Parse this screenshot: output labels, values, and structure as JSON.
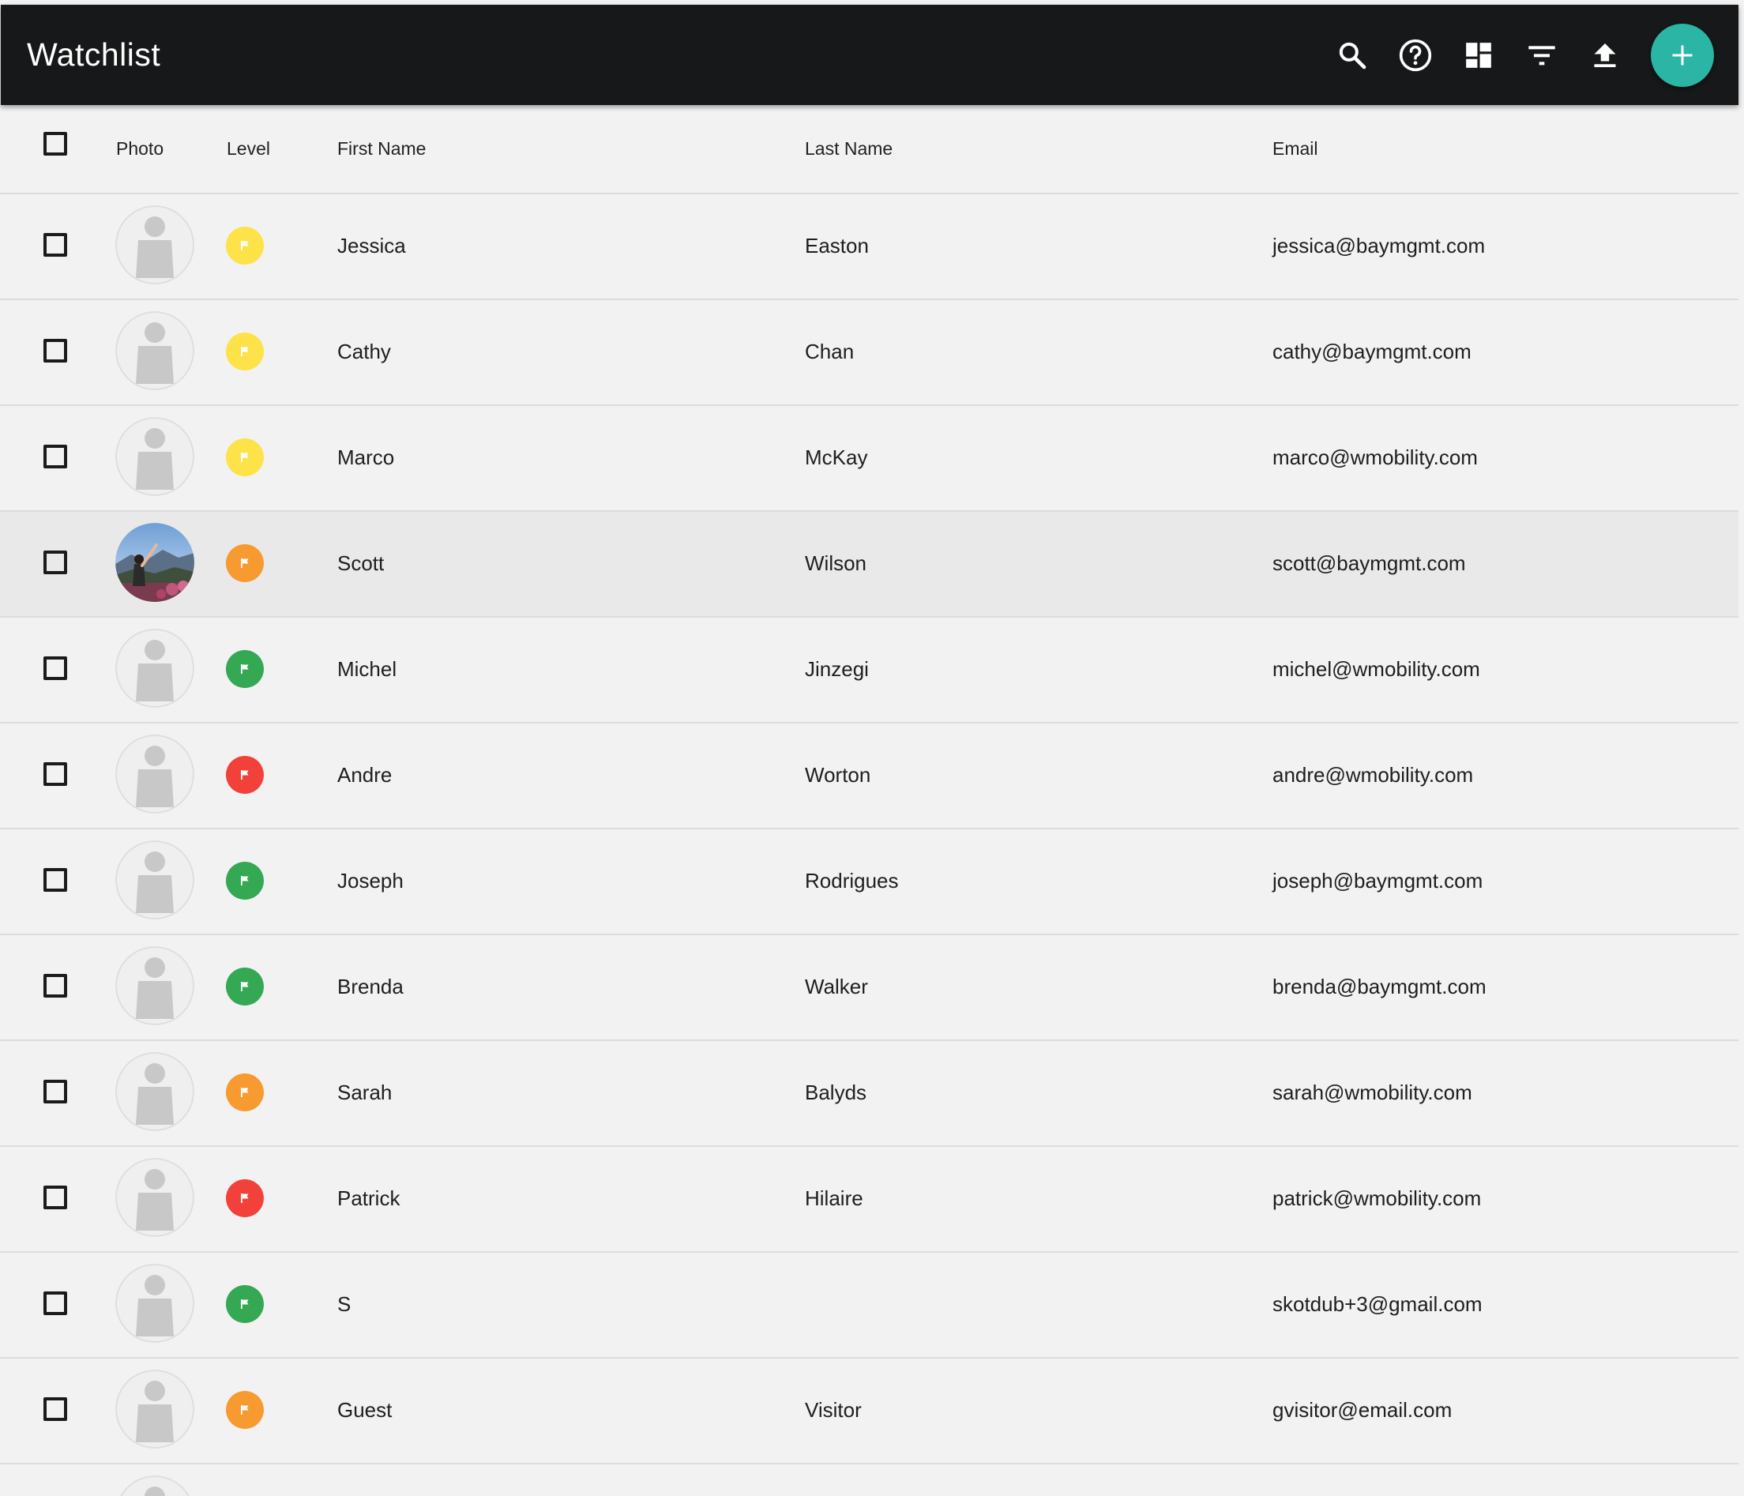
{
  "app": {
    "title": "Watchlist",
    "toolbar_icons": [
      "search-icon",
      "help-icon",
      "dashboard-icon",
      "filter-icon",
      "upload-icon"
    ],
    "fab_icon": "add-icon",
    "accent_color": "#2bb5a4",
    "toolbar_color": "#17181a"
  },
  "table": {
    "columns": {
      "photo": "Photo",
      "level": "Level",
      "first_name": "First Name",
      "last_name": "Last Name",
      "email": "Email"
    },
    "level_colors": {
      "yellow": "#fde24a",
      "orange": "#f79a2f",
      "green": "#34a853",
      "red": "#f2413a"
    },
    "rows": [
      {
        "first": "Jessica",
        "last": "Easton",
        "email": "jessica@baymgmt.com",
        "level": "yellow",
        "photo": "placeholder"
      },
      {
        "first": "Cathy",
        "last": "Chan",
        "email": "cathy@baymgmt.com",
        "level": "yellow",
        "photo": "placeholder"
      },
      {
        "first": "Marco",
        "last": "McKay",
        "email": "marco@wmobility.com",
        "level": "yellow",
        "photo": "placeholder"
      },
      {
        "first": "Scott",
        "last": "Wilson",
        "email": "scott@baymgmt.com",
        "level": "orange",
        "photo": "photo",
        "selected": true
      },
      {
        "first": "Michel",
        "last": "Jinzegi",
        "email": "michel@wmobility.com",
        "level": "green",
        "photo": "placeholder"
      },
      {
        "first": "Andre",
        "last": "Worton",
        "email": "andre@wmobility.com",
        "level": "red",
        "photo": "placeholder"
      },
      {
        "first": "Joseph",
        "last": "Rodrigues",
        "email": "joseph@baymgmt.com",
        "level": "green",
        "photo": "placeholder"
      },
      {
        "first": "Brenda",
        "last": "Walker",
        "email": "brenda@baymgmt.com",
        "level": "green",
        "photo": "placeholder"
      },
      {
        "first": "Sarah",
        "last": "Balyds",
        "email": "sarah@wmobility.com",
        "level": "orange",
        "photo": "placeholder"
      },
      {
        "first": "Patrick",
        "last": "Hilaire",
        "email": "patrick@wmobility.com",
        "level": "red",
        "photo": "placeholder"
      },
      {
        "first": "S",
        "last": "",
        "email": "skotdub+3@gmail.com",
        "level": "green",
        "photo": "placeholder"
      },
      {
        "first": "Guest",
        "last": "Visitor",
        "email": "gvisitor@email.com",
        "level": "orange",
        "photo": "placeholder"
      },
      {
        "first": "",
        "last": "",
        "email": "",
        "level": "none",
        "photo": "placeholder"
      }
    ]
  }
}
